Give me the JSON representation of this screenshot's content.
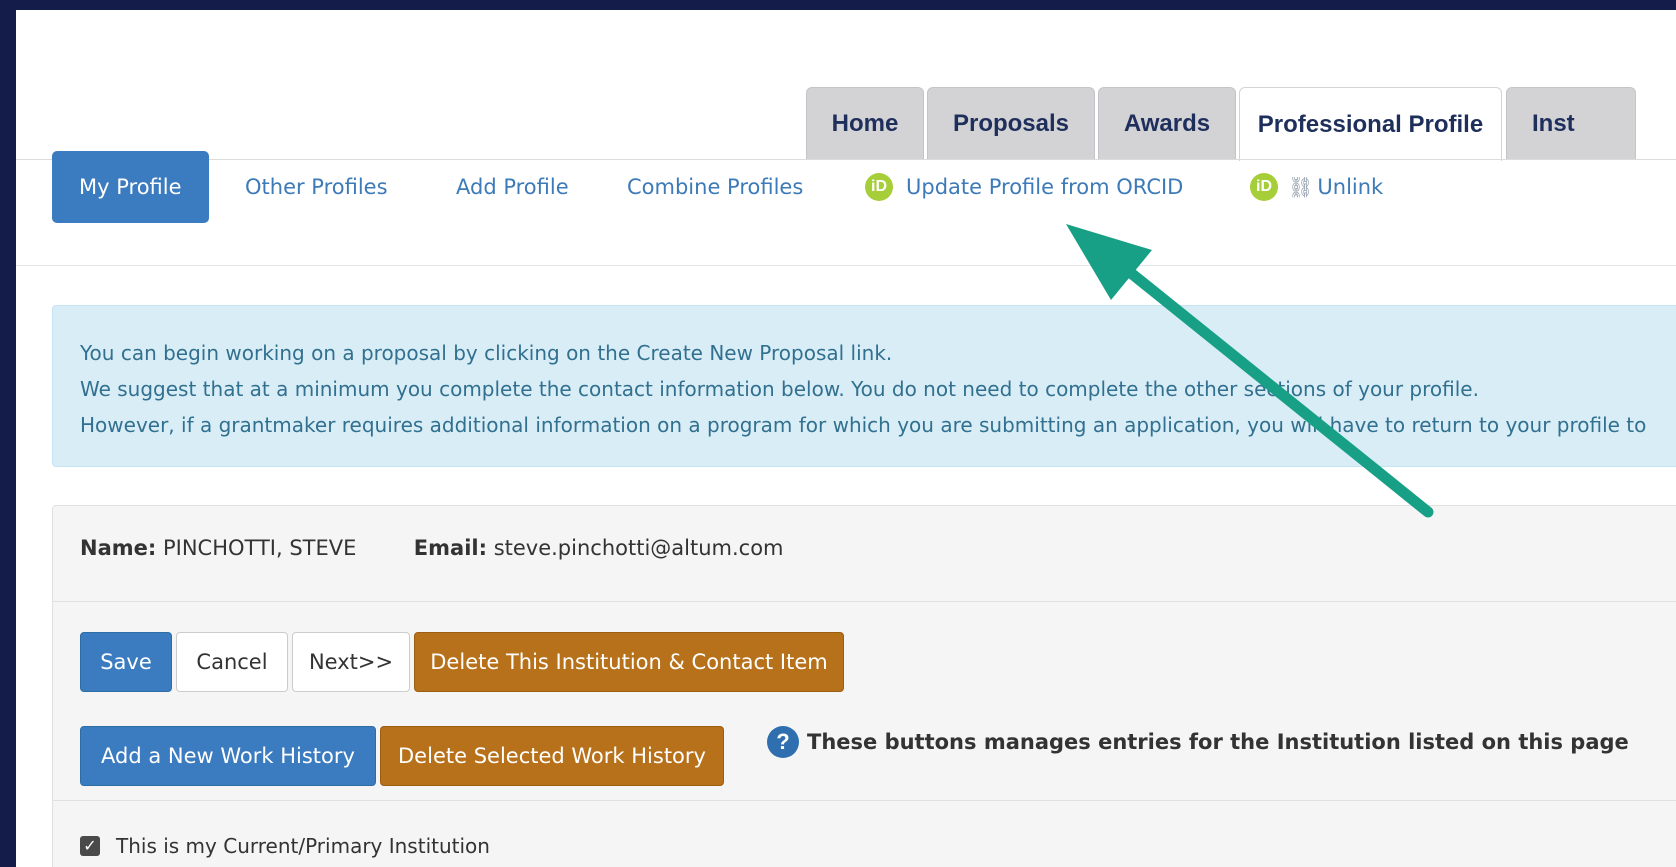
{
  "top_tabs": [
    {
      "label": "Home",
      "active": false
    },
    {
      "label": "Proposals",
      "active": false
    },
    {
      "label": "Awards",
      "active": false
    },
    {
      "label": "Professional Profile",
      "active": true
    },
    {
      "label": "Inst",
      "active": false
    }
  ],
  "sub_nav": {
    "my_profile": "My Profile",
    "other_profiles": "Other Profiles",
    "add_profile": "Add Profile",
    "combine_profiles": "Combine Profiles",
    "update_orcid": "Update Profile from ORCID",
    "unlink": "Unlink",
    "orcid_glyph": "iD",
    "unlink_icon": "broken-link-icon"
  },
  "info": {
    "line1": "You can begin working on a proposal by clicking on the Create New Proposal link.",
    "line2": "We suggest that at a minimum you complete the contact information below. You do not need to complete the other sections of your profile.",
    "line3": "However, if a grantmaker requires additional information on a program for which you are submitting an application, you will have to return to your profile to"
  },
  "profile": {
    "name_label": "Name:",
    "name_value": "PINCHOTTI, STEVE",
    "email_label": "Email:",
    "email_value": "steve.pinchotti@altum.com"
  },
  "actions": {
    "save": "Save",
    "cancel": "Cancel",
    "next": "Next>>",
    "delete_institution": "Delete This Institution & Contact Item",
    "add_work_history": "Add a New Work History",
    "delete_work_history": "Delete Selected Work History",
    "help_glyph": "?",
    "help_text": "These buttons manages entries for the Institution listed on this page"
  },
  "primary_institution": {
    "label": "This is my Current/Primary Institution",
    "checked": true
  },
  "colors": {
    "primary": "#3b7bbf",
    "warning": "#b7711a",
    "orcid": "#a6ce39",
    "info_bg": "#d9edf7",
    "annotation_arrow": "#17a085",
    "backdrop": "#141c4a"
  }
}
